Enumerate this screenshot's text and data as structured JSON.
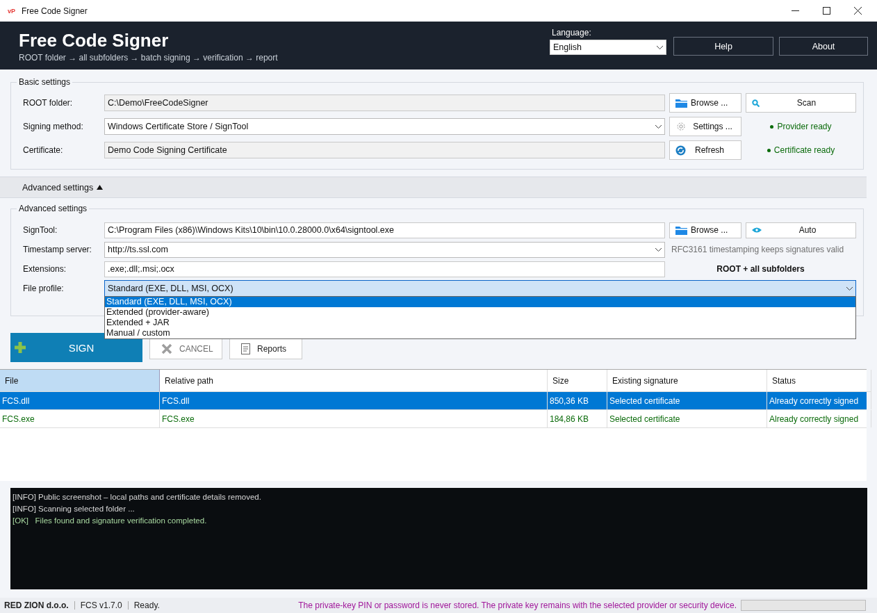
{
  "window": {
    "title": "Free Code Signer",
    "logo": "vP"
  },
  "header": {
    "title": "Free Code Signer",
    "subtitle": "ROOT folder → all subfolders → batch signing → verification → report",
    "language_label": "Language:",
    "language": "English",
    "buttons": [
      "Help",
      "About"
    ]
  },
  "basic_settings": {
    "title": "Basic settings",
    "root_folder": {
      "label": "ROOT folder:",
      "value": "C:\\Demo\\FreeCodeSigner",
      "browse": "Browse ...",
      "scan": "Scan"
    },
    "signing_method": {
      "label": "Signing method:",
      "value": "Windows Certificate Store / SignTool",
      "settings": "Settings ...",
      "status": {
        "text": "Provider ready",
        "ok": true
      }
    },
    "certificate": {
      "label": "Certificate:",
      "value": "Demo Code Signing Certificate",
      "refresh": "Refresh",
      "status": {
        "text": "Certificate ready",
        "ok": true
      }
    }
  },
  "advanced_toggle": {
    "label": "Advanced settings",
    "expanded": true
  },
  "advanced_settings": {
    "title": "Advanced settings",
    "signtool": {
      "label": "SignTool:",
      "value": "C:\\Program Files (x86)\\Windows Kits\\10\\bin\\10.0.28000.0\\x64\\signtool.exe",
      "browse": "Browse ...",
      "auto": "Auto"
    },
    "timestamp_server": {
      "label": "Timestamp server:",
      "value": "http://ts.ssl.com",
      "hint": "RFC3161 timestamping keeps signatures valid"
    },
    "extensions": {
      "label": "Extensions:",
      "value": ".exe;.dll;.msi;.ocx",
      "scope": "ROOT + all subfolders"
    },
    "file_profile": {
      "label": "File profile:",
      "value": "Standard (EXE, DLL, MSI, OCX)",
      "expanded": true,
      "options": [
        {
          "label": "Standard (EXE, DLL, MSI, OCX)",
          "selected": true
        },
        {
          "label": "Extended (provider-aware)",
          "selected": false
        },
        {
          "label": "Extended + JAR",
          "selected": false
        },
        {
          "label": "Manual / custom",
          "selected": false
        }
      ]
    }
  },
  "actions": {
    "sign": {
      "label": "SIGN",
      "disabled": false
    },
    "cancel": {
      "label": "CANCEL",
      "disabled": true
    },
    "reports": {
      "label": "Reports",
      "disabled": false
    }
  },
  "table": {
    "columns": [
      "File",
      "Relative path",
      "Size",
      "Existing signature",
      "Status"
    ],
    "rows": [
      {
        "cells": [
          "FCS.dll",
          "FCS.dll",
          "850,36 KB",
          "Selected certificate",
          "Already correctly signed"
        ],
        "selected": true
      },
      {
        "cells": [
          "FCS.exe",
          "FCS.exe",
          "184,86 KB",
          "Selected certificate",
          "Already correctly signed"
        ],
        "selected": false
      }
    ]
  },
  "log": [
    {
      "kind": "info",
      "text": "[INFO] Public screenshot – local paths and certificate details removed."
    },
    {
      "kind": "info",
      "text": "[INFO] Scanning selected folder ..."
    },
    {
      "kind": "ok",
      "text": "[OK]   Files found and signature verification completed."
    }
  ],
  "status_bar": {
    "company": "RED ZION d.o.o.",
    "version": "FCS v1.7.0",
    "state": "Ready.",
    "notice": "The private-key PIN or password is never stored. The private key remains with the selected provider or security device.",
    "progress": {
      "level": 0
    }
  }
}
